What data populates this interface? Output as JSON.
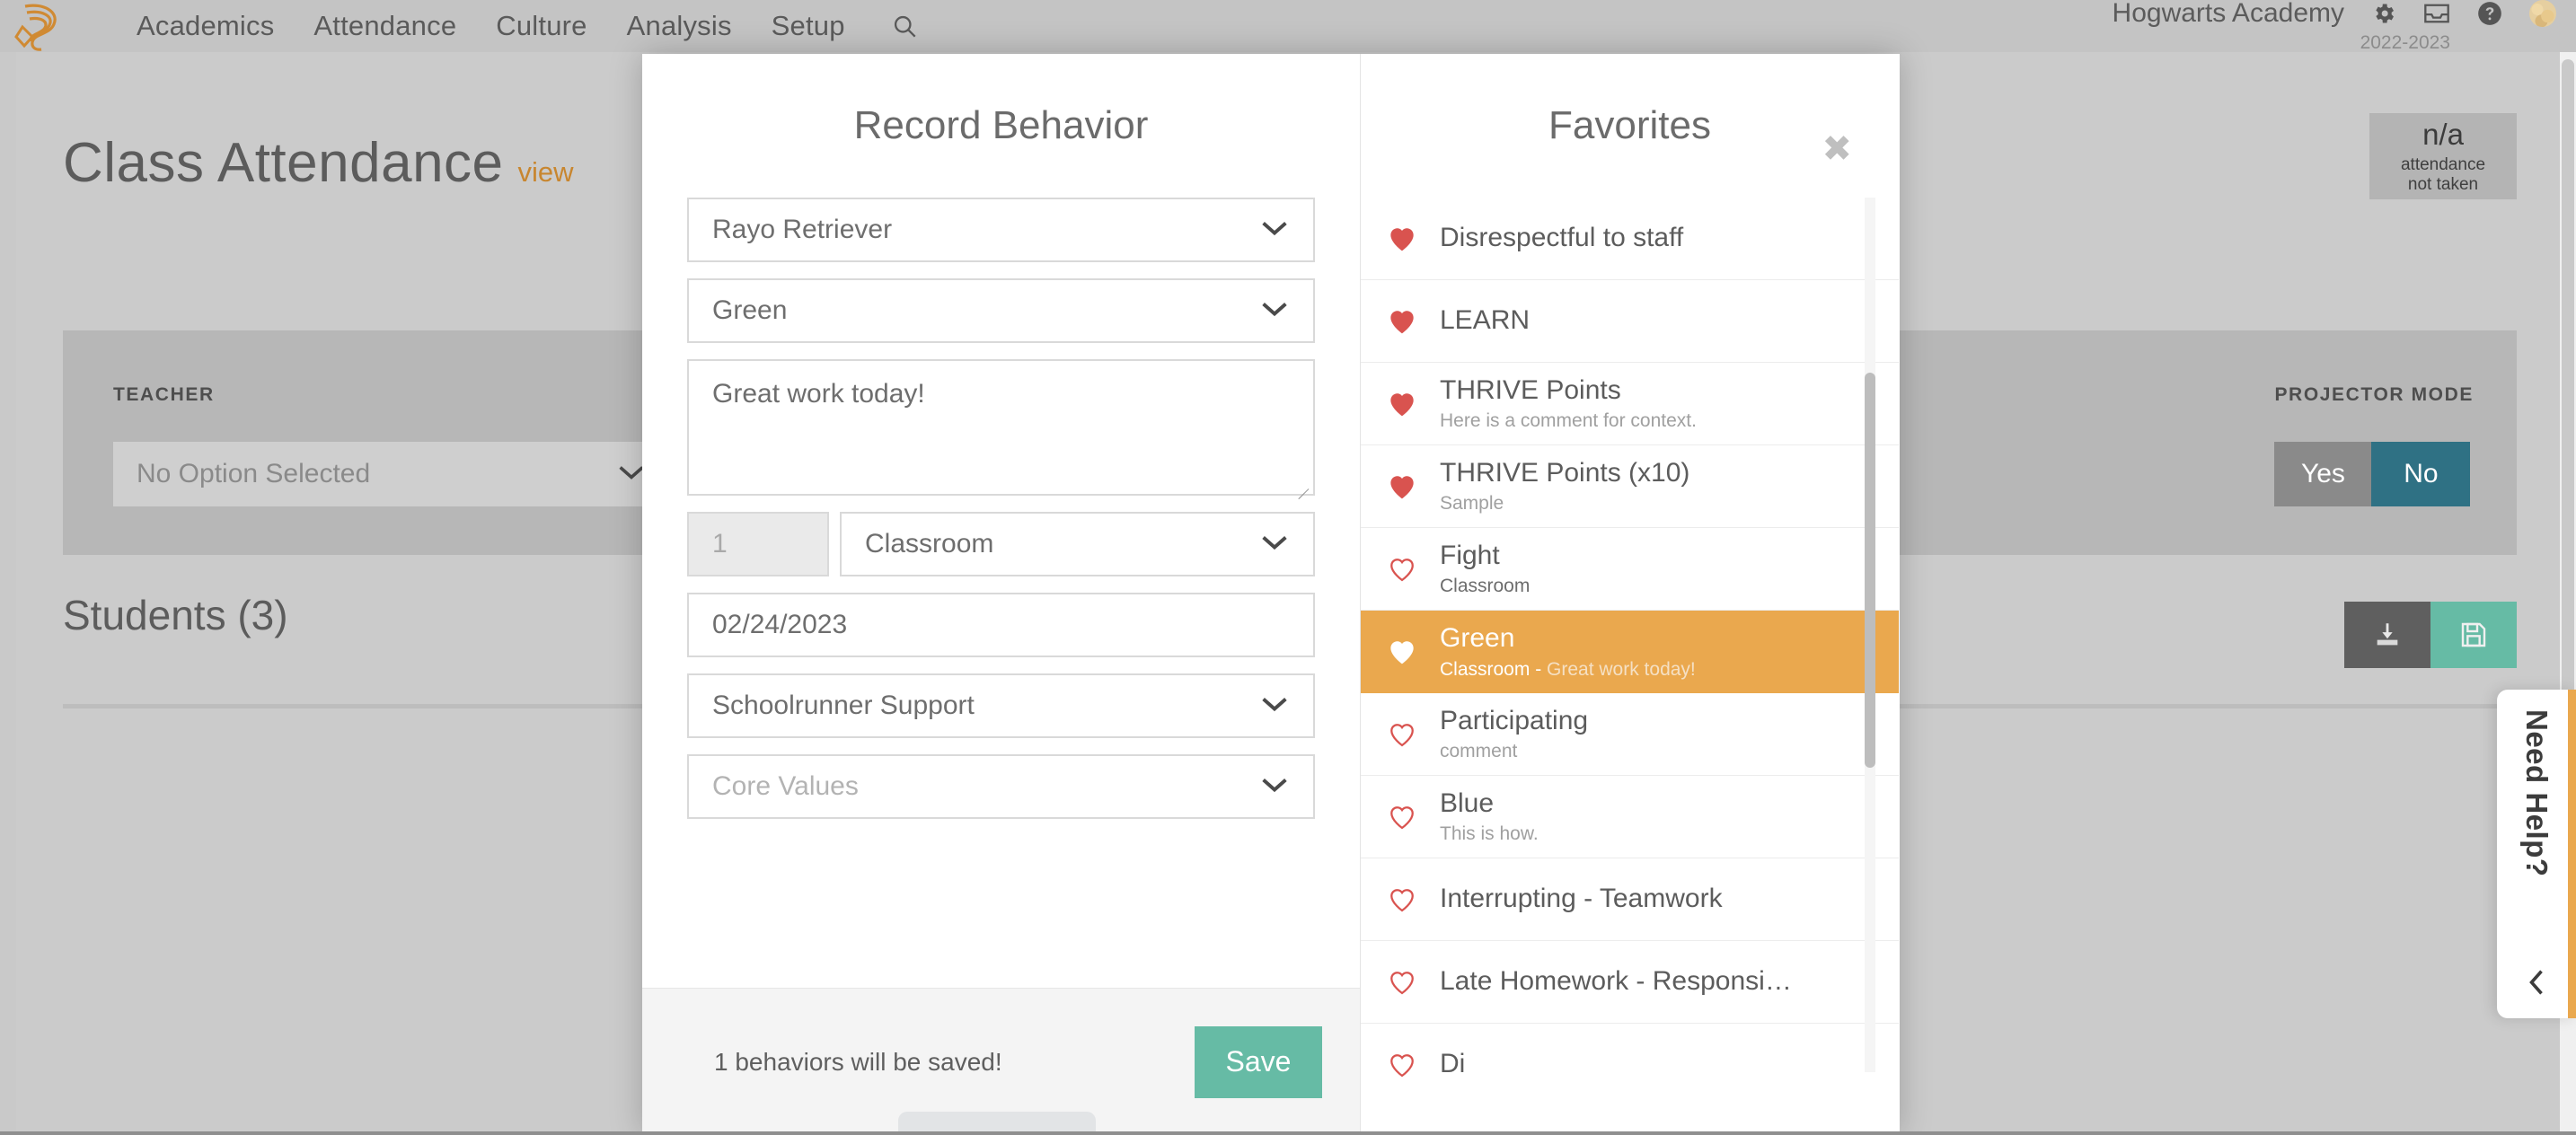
{
  "topnav": {
    "logo_name": "schoolrunner-logo",
    "items": [
      {
        "label": "Academics"
      },
      {
        "label": "Attendance"
      },
      {
        "label": "Culture"
      },
      {
        "label": "Analysis"
      },
      {
        "label": "Setup"
      }
    ],
    "search_icon": "search-icon",
    "school_name": "Hogwarts Academy",
    "school_year": "2022-2023",
    "icons": [
      {
        "name": "gear-icon"
      },
      {
        "name": "inbox-icon"
      },
      {
        "name": "help-circle-icon"
      },
      {
        "name": "avatar"
      }
    ]
  },
  "page": {
    "title": "Class Attendance",
    "view_link": "view",
    "attendance_card": {
      "value": "n/a",
      "line1": "attendance",
      "line2": "not taken"
    },
    "filters": {
      "teacher_label": "TEACHER",
      "teacher_value": "No Option Selected",
      "projector_label": "PROJECTOR MODE",
      "projector_yes": "Yes",
      "projector_no": "No",
      "projector_selected": "No"
    },
    "students_heading": "Students (3)",
    "actions": [
      {
        "name": "download-icon"
      },
      {
        "name": "save-disk-icon"
      }
    ]
  },
  "modal": {
    "left_title": "Record Behavior",
    "right_title": "Favorites",
    "close_label": "✖",
    "form": {
      "student": {
        "value": "Rayo Retriever",
        "is_placeholder": false
      },
      "behavior": {
        "value": "Green",
        "is_placeholder": false
      },
      "comment": {
        "value": "Great work today!",
        "is_placeholder": false
      },
      "quantity": {
        "value": "1"
      },
      "location": {
        "value": "Classroom"
      },
      "date": {
        "value": "02/24/2023"
      },
      "recorded_by": {
        "value": "Schoolrunner Support"
      },
      "core_values": {
        "value": "Core Values",
        "is_placeholder": true
      }
    },
    "footer": {
      "message": "1 behaviors will be saved!",
      "save_label": "Save"
    },
    "favorites": [
      {
        "label": "Disrespectful to staff",
        "sub": "",
        "sub_strong": "",
        "filled": true,
        "selected": false
      },
      {
        "label": "LEARN",
        "sub": "",
        "sub_strong": "",
        "filled": true,
        "selected": false
      },
      {
        "label": "THRIVE Points",
        "sub": "Here is a comment for context.",
        "sub_strong": "",
        "filled": true,
        "selected": false
      },
      {
        "label": "THRIVE Points (x10)",
        "sub": "Sample",
        "sub_strong": "",
        "filled": true,
        "selected": false
      },
      {
        "label": "Fight",
        "sub": "",
        "sub_strong": "Classroom",
        "filled": false,
        "selected": false
      },
      {
        "label": "Green",
        "sub": "Great work today!",
        "sub_strong": "Classroom - ",
        "filled": true,
        "selected": true
      },
      {
        "label": "Participating",
        "sub": "comment",
        "sub_strong": "",
        "filled": false,
        "selected": false
      },
      {
        "label": "Blue",
        "sub": "This is how.",
        "sub_strong": "",
        "filled": false,
        "selected": false
      },
      {
        "label": "Interrupting - Teamwork",
        "sub": "",
        "sub_strong": "",
        "filled": false,
        "selected": false
      },
      {
        "label": "Late Homework - Responsi…",
        "sub": "",
        "sub_strong": "",
        "filled": false,
        "selected": false
      },
      {
        "label": "Di",
        "sub": "",
        "sub_strong": "",
        "filled": false,
        "selected": false
      }
    ]
  },
  "help_tab": {
    "label": "Need Help?",
    "chevron": "chevron-left-icon"
  },
  "colors": {
    "brand_orange": "#d08a33",
    "highlight_orange": "#eaa84e",
    "teal": "#2f7184",
    "green": "#66bba5",
    "heart_red": "#d9534f"
  }
}
